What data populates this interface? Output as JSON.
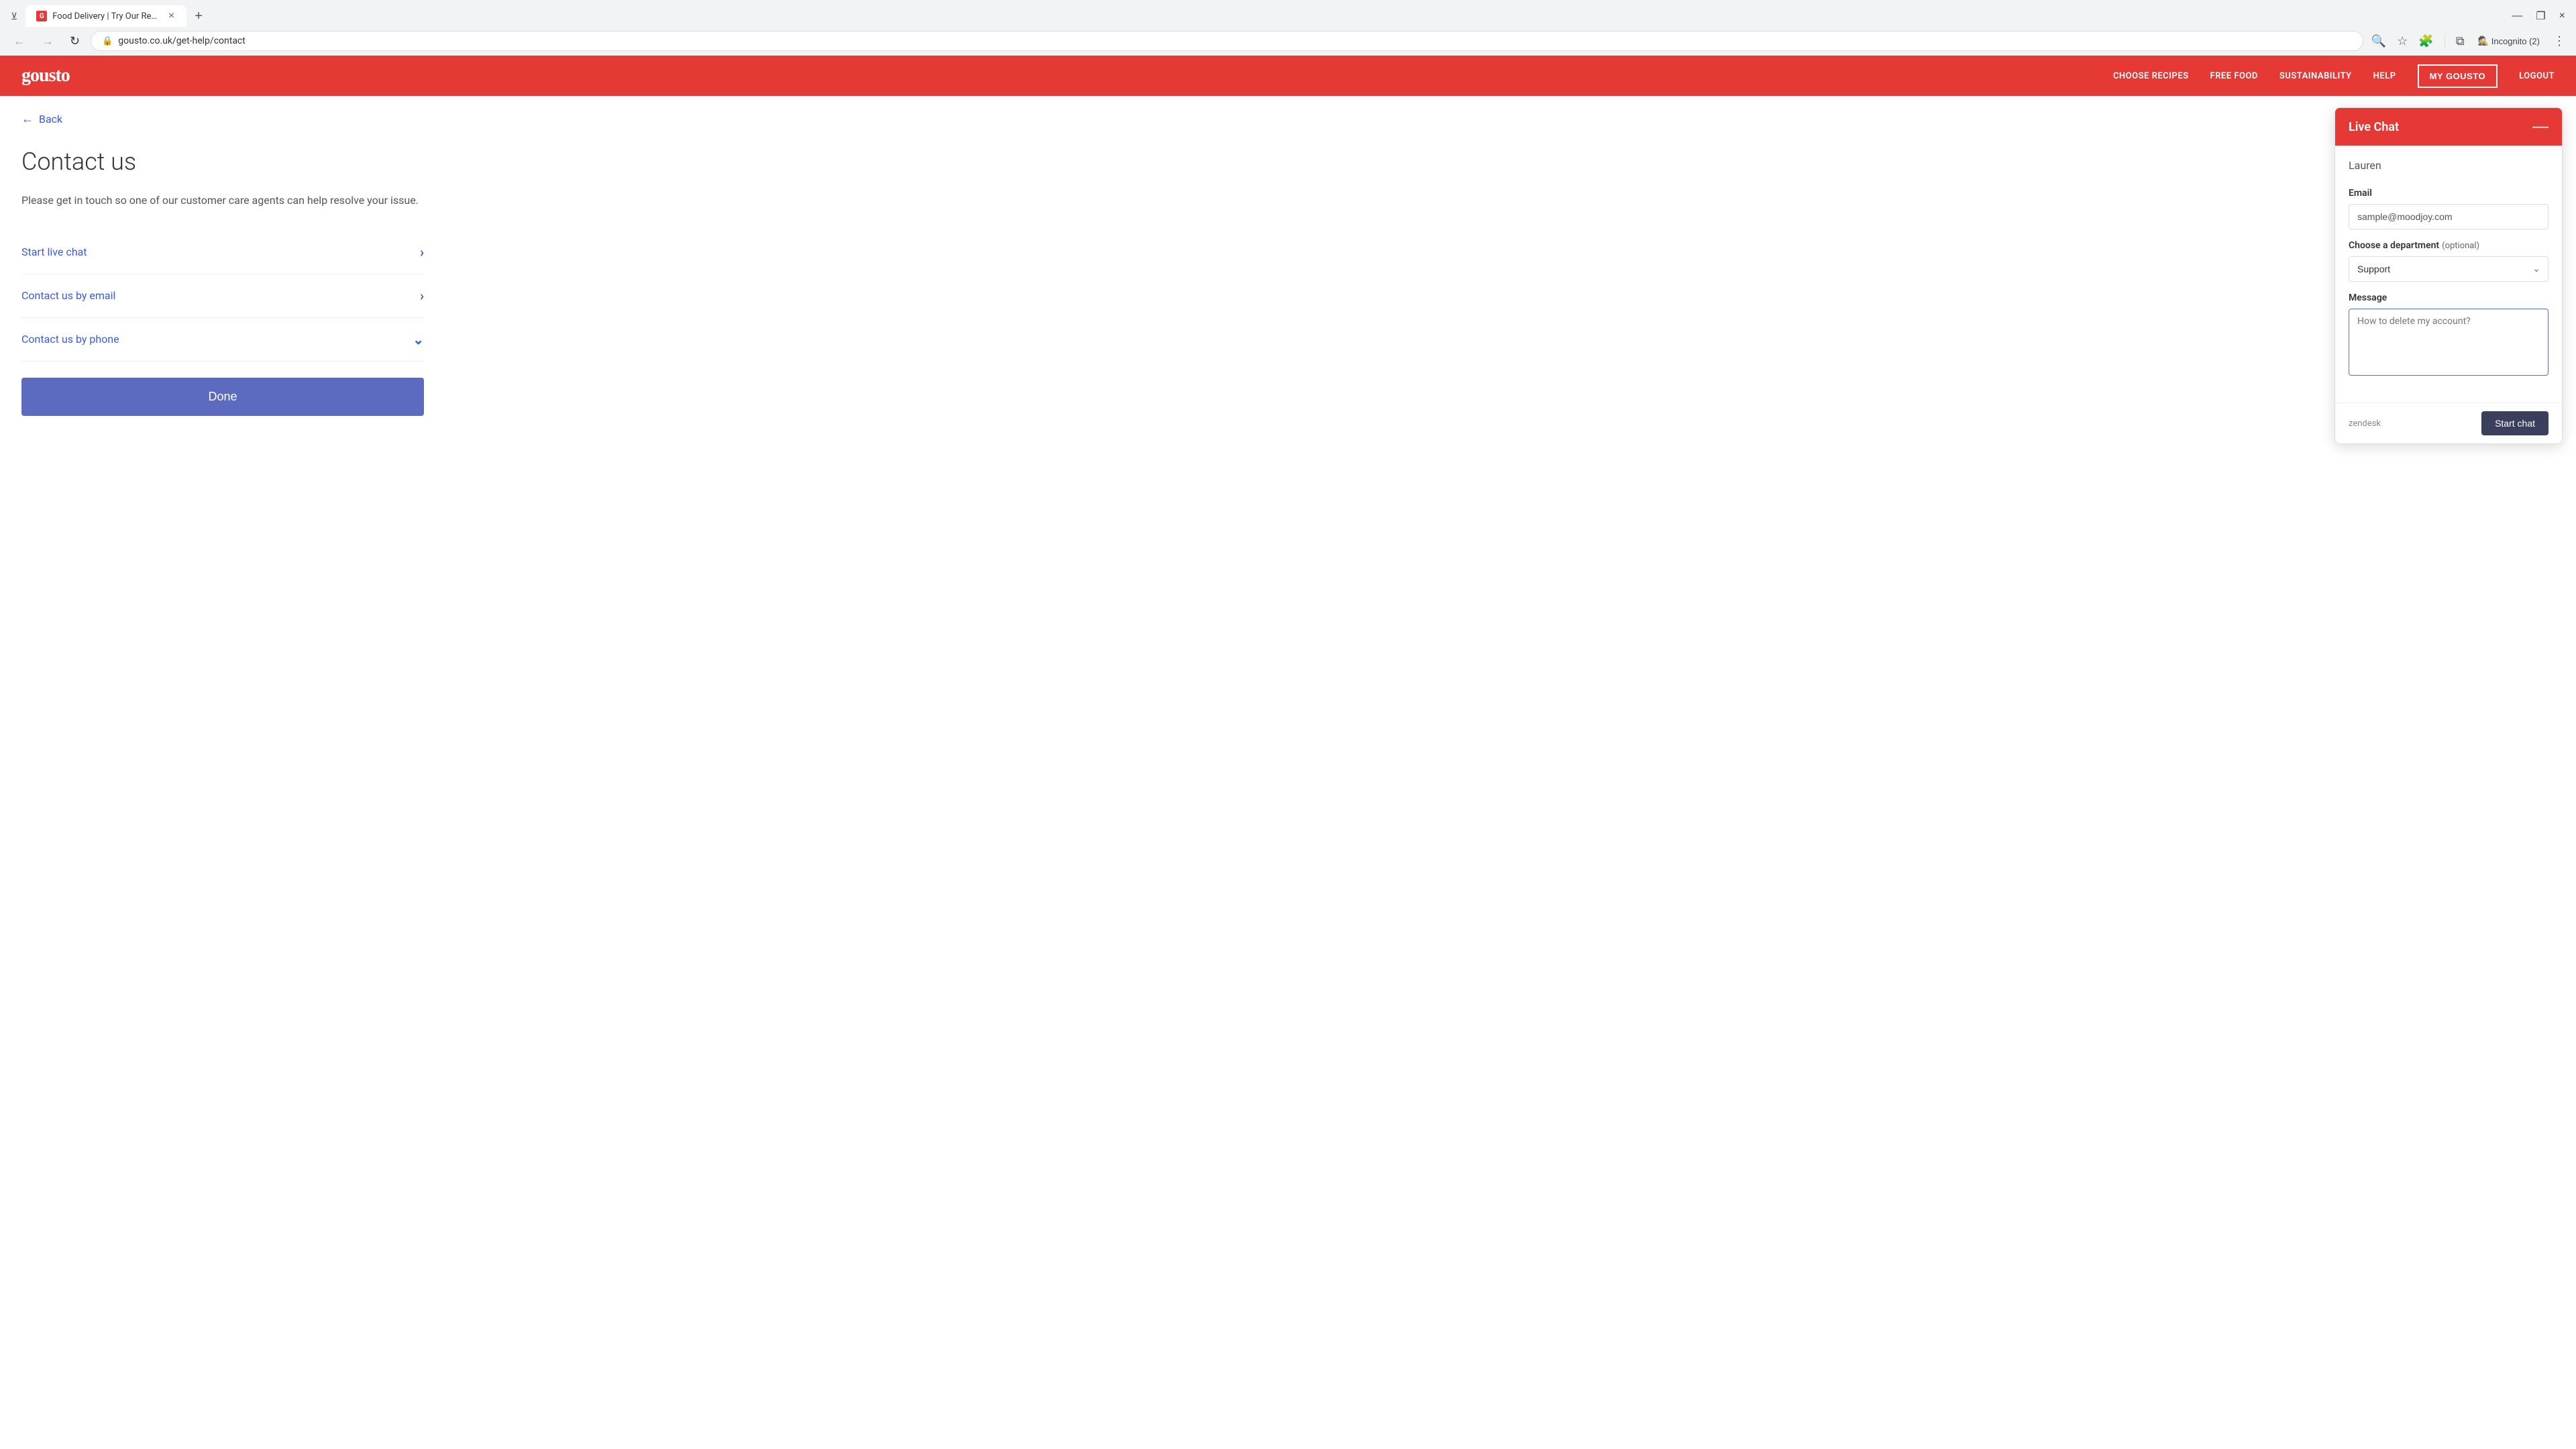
{
  "browser": {
    "tab": {
      "favicon_letter": "G",
      "title": "Food Delivery | Try Our Recipe",
      "close_label": "×",
      "new_tab_label": "+"
    },
    "nav": {
      "back_label": "←",
      "forward_label": "→",
      "refresh_label": "↻",
      "url": "gousto.co.uk/get-help/contact",
      "search_icon": "🔍",
      "bookmark_icon": "☆",
      "extensions_icon": "🧩",
      "sidebar_icon": "⧉",
      "incognito_label": "Incognito (2)",
      "menu_label": "⋮"
    },
    "window_controls": {
      "minimize": "—",
      "maximize": "❐",
      "close": "×"
    }
  },
  "site_nav": {
    "logo": "gousto",
    "links": [
      {
        "label": "CHOOSE RECIPES",
        "key": "choose-recipes"
      },
      {
        "label": "FREE FOOD",
        "key": "free-food"
      },
      {
        "label": "SUSTAINABILITY",
        "key": "sustainability"
      },
      {
        "label": "HELP",
        "key": "help"
      }
    ],
    "my_gousto_label": "MY GOUSTO",
    "logout_label": "LOGOUT"
  },
  "page": {
    "back_label": "Back",
    "title": "Contact us",
    "description": "Please get in touch so one of our customer care agents can help resolve your issue.",
    "options": [
      {
        "label": "Start live chat",
        "chevron": "›",
        "chevron_type": "right"
      },
      {
        "label": "Contact us by email",
        "chevron": "›",
        "chevron_type": "right"
      },
      {
        "label": "Contact us by phone",
        "chevron": "˅",
        "chevron_type": "down"
      }
    ],
    "done_label": "Done"
  },
  "live_chat": {
    "title": "Live Chat",
    "minimize_label": "—",
    "name_placeholder": "Lauren",
    "email_label": "Email",
    "email_value": "sample@moodjoy.com",
    "department_label": "Choose a department",
    "department_optional": "(optional)",
    "department_options": [
      "Support"
    ],
    "department_selected": "Support",
    "message_label": "Message",
    "message_placeholder": "How to delete my account?",
    "zendesk_label": "zendesk",
    "start_chat_label": "Start chat"
  }
}
